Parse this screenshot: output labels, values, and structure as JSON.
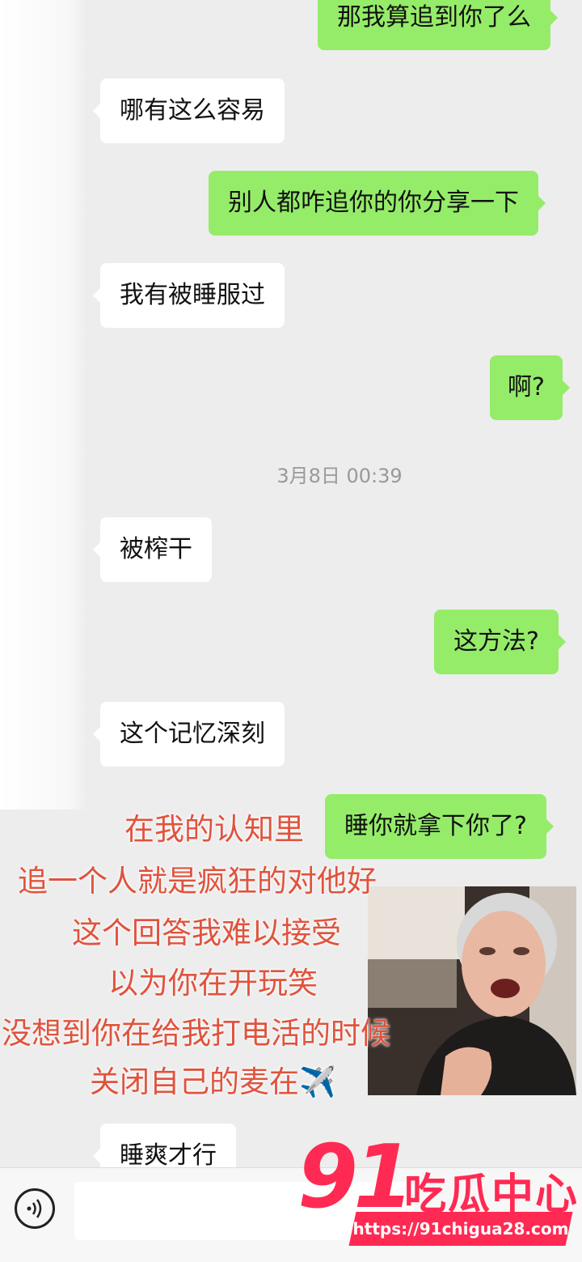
{
  "messages": [
    {
      "side": "out",
      "text": "那我算追到你了么"
    },
    {
      "side": "in",
      "text": "哪有这么容易"
    },
    {
      "side": "out",
      "text": "别人都咋追你的你分享一下"
    },
    {
      "side": "in",
      "text": "我有被睡服过"
    },
    {
      "side": "out",
      "text": "啊?"
    },
    {
      "side": "in",
      "text": "被榨干"
    },
    {
      "side": "out",
      "text": "这方法?"
    },
    {
      "side": "in",
      "text": "这个记忆深刻"
    },
    {
      "side": "out",
      "text": "睡你就拿下你了?"
    },
    {
      "side": "in",
      "text": "睡爽才行"
    }
  ],
  "timestamp": "3月8日 00:39",
  "overlay_lines": [
    "在我的认知里",
    "追一个人就是疯狂的对他好",
    "这个回答我难以接受",
    "以为你在开玩笑",
    "没想到你在给我打电活的时候",
    "关闭自己的麦在✈️"
  ],
  "watermark": {
    "number": "91",
    "name": "吃瓜中心",
    "url": "https://91chigua28.com"
  },
  "colors": {
    "out_bubble": "#95ec69",
    "in_bubble": "#ffffff",
    "overlay_text": "#e0533d",
    "watermark": "#ff2a53"
  }
}
